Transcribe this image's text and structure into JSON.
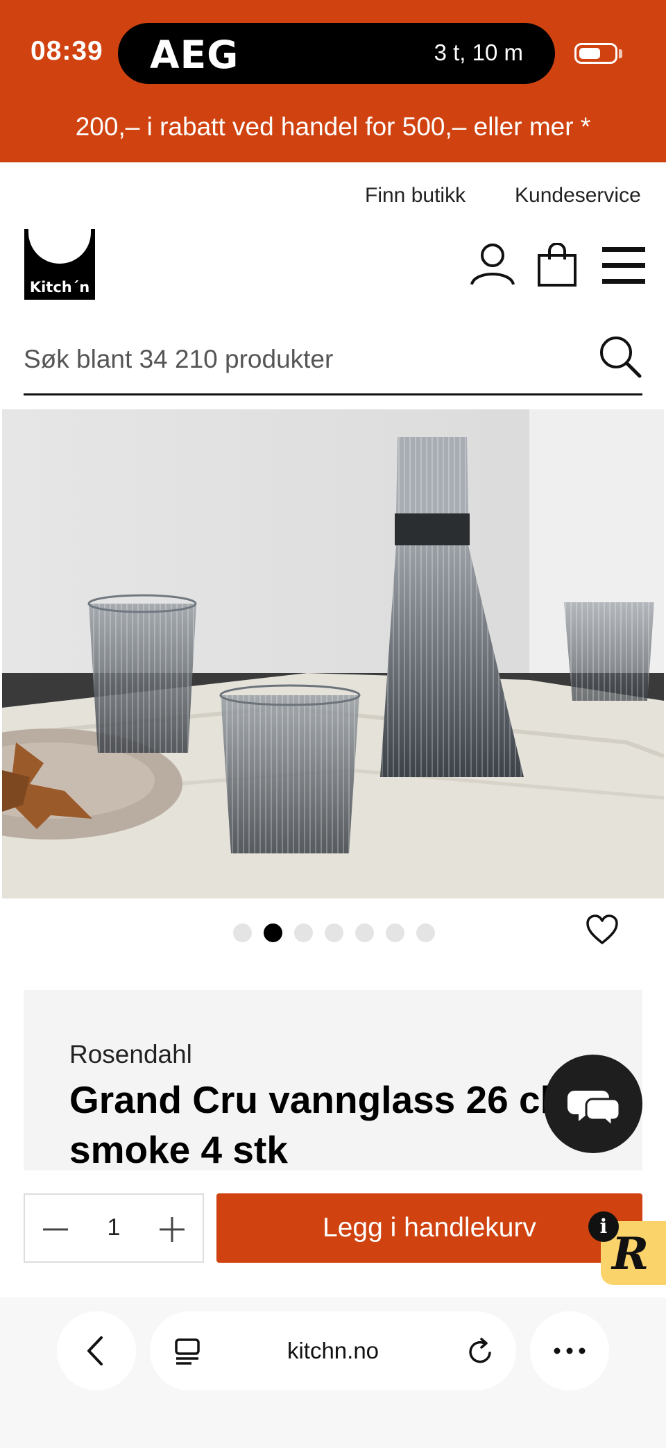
{
  "status_bar": {
    "time": "08:39",
    "live_activity": {
      "brand": "AEG",
      "remaining": "3 t, 10 m"
    },
    "battery_level": 0.6
  },
  "promo_banner": {
    "text": "200,– i rabatt ved handel for 500,– eller mer *"
  },
  "utility_links": {
    "find_store": "Finn butikk",
    "customer_service": "Kundeservice"
  },
  "header": {
    "logo_text": "Kitch´n"
  },
  "search": {
    "placeholder": "Søk blant 34 210 produkter"
  },
  "gallery": {
    "total_images": 7,
    "active_index": 1
  },
  "product": {
    "brand": "Rosendahl",
    "title": "Grand Cru vannglass 26 cl smoke 4 stk"
  },
  "purchase": {
    "quantity": "1",
    "add_to_cart_label": "Legg i handlekurv"
  },
  "badges": {
    "info": "i",
    "reviews_letter": "R"
  },
  "browser": {
    "url": "kitchn.no"
  },
  "colors": {
    "brand_orange": "#d04310",
    "chat_bubble": "#1e1e1e",
    "review_badge": "#fbd36b"
  }
}
